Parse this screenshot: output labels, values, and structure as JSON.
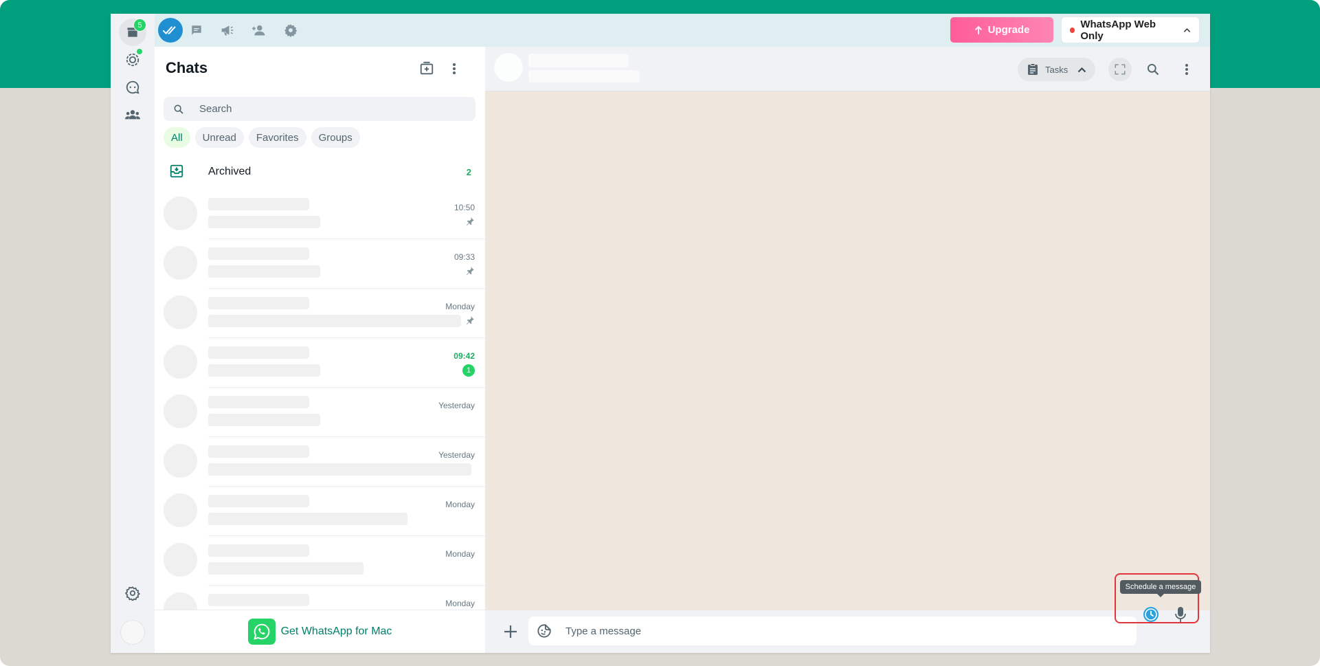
{
  "extension_bar": {
    "upgrade_label": "Upgrade",
    "mode_label": "WhatsApp Web Only",
    "icons": [
      "double-check-logo-icon",
      "message-icon",
      "megaphone-icon",
      "add-contact-icon",
      "gear-icon"
    ]
  },
  "rail": {
    "archive_badge": "5",
    "icons": [
      "archive-box-icon",
      "status-icon",
      "channels-icon",
      "communities-icon",
      "gear-icon"
    ]
  },
  "chats": {
    "title": "Chats",
    "search_placeholder": "Search",
    "filters": [
      "All",
      "Unread",
      "Favorites",
      "Groups"
    ],
    "active_filter": "All",
    "archived_label": "Archived",
    "archived_count": "2",
    "rows": [
      {
        "time": "10:50",
        "pinned": true,
        "unread": false,
        "badge": ""
      },
      {
        "time": "09:33",
        "pinned": true,
        "unread": false,
        "badge": ""
      },
      {
        "time": "Monday",
        "pinned": true,
        "unread": false,
        "badge": ""
      },
      {
        "time": "09:42",
        "pinned": false,
        "unread": true,
        "badge": "1"
      },
      {
        "time": "Yesterday",
        "pinned": false,
        "unread": false,
        "badge": ""
      },
      {
        "time": "Yesterday",
        "pinned": false,
        "unread": false,
        "badge": ""
      },
      {
        "time": "Monday",
        "pinned": false,
        "unread": false,
        "badge": ""
      },
      {
        "time": "Monday",
        "pinned": false,
        "unread": false,
        "badge": ""
      },
      {
        "time": "Monday",
        "pinned": false,
        "unread": false,
        "badge": ""
      }
    ],
    "get_app_label": "Get WhatsApp for Mac"
  },
  "conversation": {
    "tasks_label": "Tasks",
    "message_placeholder": "Type a message",
    "tooltip": "Schedule a message"
  },
  "colors": {
    "brand_green": "#00a07f",
    "accent_green": "#25d366",
    "upgrade_pink": "#ff6fa5",
    "highlight_red": "#e0353a",
    "schedule_blue": "#2aa3dc"
  }
}
